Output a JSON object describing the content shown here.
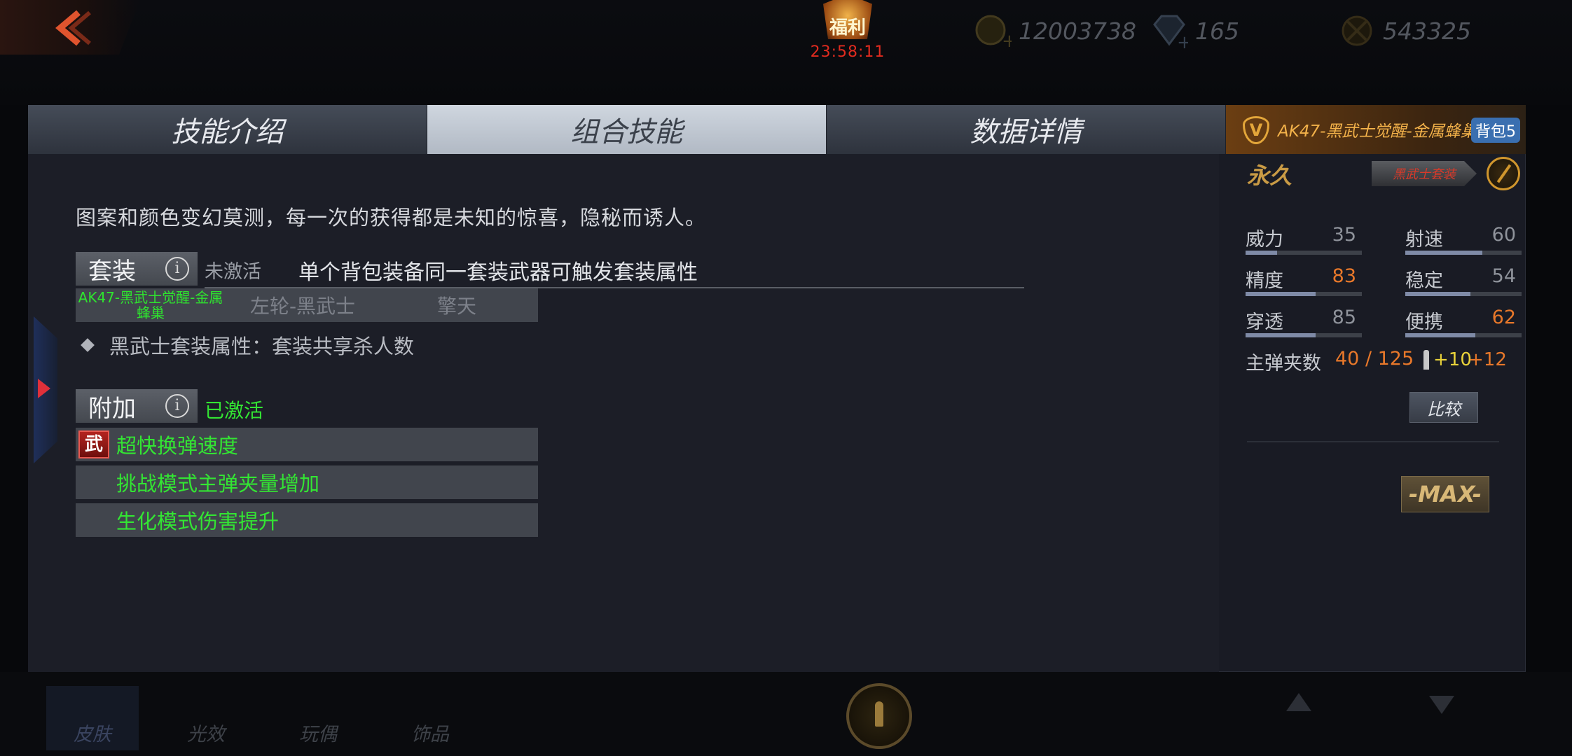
{
  "top_bar": {
    "welfare_label": "福利",
    "welfare_timer": "23:58:11",
    "gold": "12003738",
    "diamond": "165",
    "honor": "543325"
  },
  "tabs": [
    {
      "label": "技能介绍",
      "active": false
    },
    {
      "label": "组合技能",
      "active": true
    },
    {
      "label": "数据详情",
      "active": false
    }
  ],
  "skill": {
    "description": "图案和颜色变幻莫测，每一次的获得都是未知的惊喜，隐秘而诱人。",
    "suit": {
      "label": "套装",
      "status": "未激活",
      "desc": "单个背包装备同一套装武器可触发套装属性",
      "items": [
        "AK47-黑武士觉醒-金属蜂巢",
        "左轮-黑武士",
        "擎天"
      ],
      "bonus": "黑武士套装属性：套装共享杀人数"
    },
    "extra": {
      "label": "附加",
      "status": "已激活",
      "badge": "武",
      "bonuses": [
        "超快换弹速度",
        "挑战模式主弹夹量增加",
        "生化模式伤害提升"
      ]
    }
  },
  "weapon": {
    "badge": "V",
    "name": "AK47-黑武士觉醒-金属蜂巢",
    "bag": "背包5",
    "duration": "永久",
    "skin_tag": "黑武士套装",
    "stats": {
      "power": {
        "label": "威力",
        "value": "35",
        "fill": 0.27
      },
      "rate": {
        "label": "射速",
        "value": "60",
        "fill": 0.66
      },
      "accuracy": {
        "label": "精度",
        "value": "83",
        "fill": 0.6
      },
      "stability": {
        "label": "稳定",
        "value": "54",
        "fill": 0.56
      },
      "penetration": {
        "label": "穿透",
        "value": "85",
        "fill": 0.6
      },
      "portability": {
        "label": "便携",
        "value": "62",
        "fill": 0.6
      }
    },
    "mag_label": "主弹夹数",
    "mag_value": "40 / 125",
    "mag_plus1": "+10",
    "mag_plus2": "+12",
    "compare": "比较",
    "max": "-MAX-"
  },
  "bottom_tabs": [
    "皮肤",
    "光效",
    "玩偶",
    "饰品"
  ],
  "colors": {
    "active_green": "#33e533",
    "accent_orange": "#e8782a",
    "gold": "#f3b24a"
  }
}
